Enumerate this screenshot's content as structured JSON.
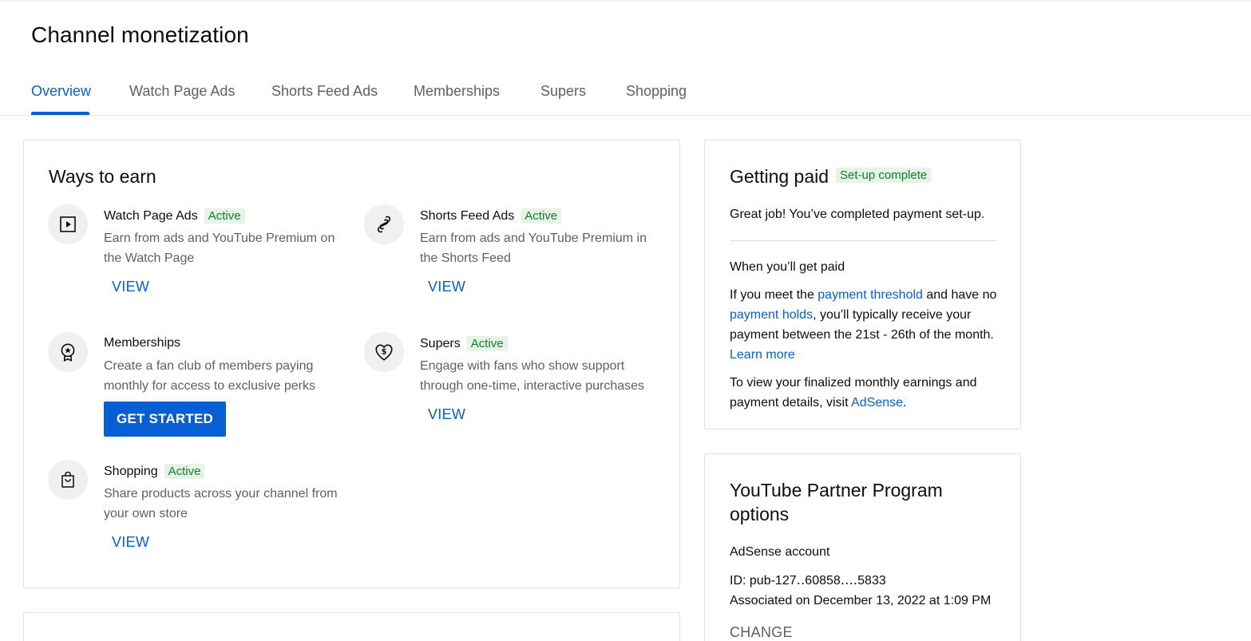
{
  "page_title": "Channel monetization",
  "tabs": [
    {
      "label": "Overview",
      "active": true
    },
    {
      "label": "Watch Page Ads"
    },
    {
      "label": "Shorts Feed Ads"
    },
    {
      "label": "Memberships"
    },
    {
      "label": "Supers"
    },
    {
      "label": "Shopping"
    }
  ],
  "ways_to_earn": {
    "title": "Ways to earn",
    "items": [
      {
        "name": "Watch Page Ads",
        "badge": "Active",
        "description": "Earn from ads and YouTube Premium on the Watch Page",
        "action": "VIEW",
        "icon": "play-icon"
      },
      {
        "name": "Shorts Feed Ads",
        "badge": "Active",
        "description": "Earn from ads and YouTube Premium in the Shorts Feed",
        "action": "VIEW",
        "icon": "shorts-icon"
      },
      {
        "name": "Memberships",
        "badge": "",
        "description": "Create a fan club of members paying monthly for access to exclusive perks",
        "action": "GET STARTED",
        "icon": "membership-badge-icon"
      },
      {
        "name": "Supers",
        "badge": "Active",
        "description": "Engage with fans who show support through one-time, interactive purchases",
        "action": "VIEW",
        "icon": "heart-dollar-icon"
      },
      {
        "name": "Shopping",
        "badge": "Active",
        "description": "Share products across your channel from your own store",
        "action": "VIEW",
        "icon": "shopping-bag-icon"
      }
    ]
  },
  "getting_paid": {
    "title": "Getting paid",
    "badge": "Set-up complete",
    "message": "Great job! You’ve completed payment set-up.",
    "when_title": "When you’ll get paid",
    "p1_a": "If you meet the ",
    "p1_link1": "payment threshold",
    "p1_b": " and have no ",
    "p1_link2": "payment holds",
    "p1_c": ", you’ll typically receive your payment between the 21st - 26th of the month. ",
    "p1_link3": "Learn more",
    "p2_a": "To view your finalized monthly earnings and payment details, visit ",
    "p2_link": "AdSense",
    "p2_b": "."
  },
  "partner_program": {
    "title": "YouTube Partner Program options",
    "adsense_title": "AdSense account",
    "id_label": "ID: pub-127‥60858‥‥5833",
    "associated": "Associated on December 13, 2022 at 1:09 PM",
    "change_label": "CHANGE"
  },
  "colors": {
    "accent": "#065fd4",
    "active_badge_text": "#0f7b2d",
    "active_badge_bg": "#e6f4e6"
  }
}
